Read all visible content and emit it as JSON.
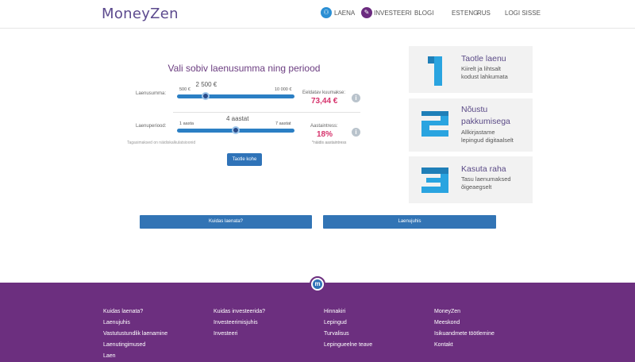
{
  "header": {
    "logo": "MoneyZen",
    "nav": {
      "laena": "LAENA",
      "investeeri": "INVESTEERI",
      "blogi": "BLOGI",
      "est": "EST",
      "eng": "ENG",
      "rus": "RUS",
      "login": "LOGI SISSE"
    }
  },
  "calculator": {
    "title": "Vali sobiv laenusumma ning periood",
    "amount": {
      "label": "Laenusumma:",
      "value": "2 500 €",
      "min": "500 €",
      "max": "10 000 €",
      "fraction": 0.24
    },
    "monthly": {
      "label": "Eeldatav kuumakse:",
      "value": "73,44 €"
    },
    "period": {
      "label": "Laenuperiood:",
      "value": "4 aastat",
      "min": "1 aasta",
      "max": "7 aastat",
      "fraction": 0.5
    },
    "interest": {
      "label": "Aastaintress:",
      "value": "18%",
      "note": "*näidis aastaintress"
    },
    "repayment_note": "Tagasimaksed on näidiskalkulatsioonid",
    "apply_button": "Taotle kohe"
  },
  "steps": [
    {
      "number": "1",
      "title": "Taotle laenu",
      "desc": [
        "Kiirelt ja lihtsalt",
        "kodust lahkumata"
      ]
    },
    {
      "number": "2",
      "title": "Nõustu",
      "title2": "pakkumisega",
      "desc": [
        "Allkirjastame",
        "lepingud digitaalselt"
      ]
    },
    {
      "number": "3",
      "title": "Kasuta raha",
      "desc": [
        "Tasu laenumaksed",
        "õigeaegselt"
      ]
    }
  ],
  "bars": {
    "left": "Kuidas laenata?",
    "right": "Laenujuhis"
  },
  "footer": {
    "col1": [
      "Kuidas laenata?",
      "Laenujuhis",
      "Vastutustundlik laenamine",
      "Laenutingimused",
      "Laen"
    ],
    "col2": [
      "Kuidas investeerida?",
      "Investeerimisjuhis",
      "Investeeri"
    ],
    "col3": [
      "Hinnakiri",
      "Lepingud",
      "Turvalisus",
      "Lepingueelne teave"
    ],
    "col4": [
      "MoneyZen",
      "Meeskond",
      "Isikuandmete töötlemine",
      "Kontakt"
    ]
  },
  "colors": {
    "brand_purple": "#6c2f7f",
    "accent_blue": "#2f73b8",
    "highlight_pink": "#d6336c"
  },
  "icons": {
    "laena": "users-icon",
    "investeeri": "chart-icon",
    "info": "info-icon",
    "footer_logo": "moneyzen-logo-icon"
  }
}
